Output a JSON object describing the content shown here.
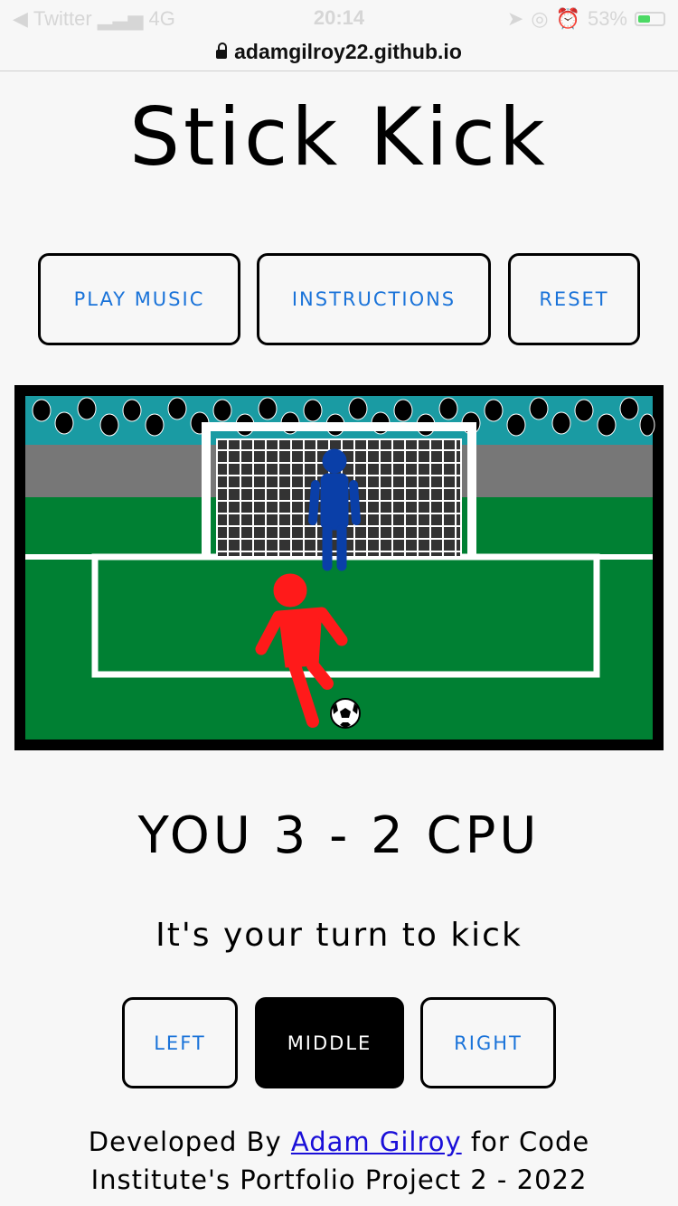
{
  "status_bar": {
    "back_app": "Twitter",
    "network": "4G",
    "time": "20:14",
    "battery": "53%"
  },
  "browser": {
    "url": "adamgilroy22.github.io"
  },
  "page": {
    "title": "Stick Kick"
  },
  "controls": {
    "play_music": "PLAY MUSIC",
    "instructions": "INSTRUCTIONS",
    "reset": "RESET"
  },
  "scoreboard": {
    "text": "YOU 3 - 2 CPU"
  },
  "message": {
    "text": "It's your turn to kick"
  },
  "kick_options": {
    "left": "LEFT",
    "middle": "MIDDLE",
    "right": "RIGHT",
    "selected": "middle"
  },
  "footer": {
    "prefix": "Developed By ",
    "author": "Adam Gilroy",
    "suffix_line1": " for Code",
    "line2": "Institute's Portfolio Project 2 - 2022"
  },
  "colors": {
    "accent": "#1a73d9",
    "pitch": "#008033",
    "crowd": "#1a9ba3",
    "keeper": "#0a3fa8",
    "player": "#ff1a1a"
  }
}
